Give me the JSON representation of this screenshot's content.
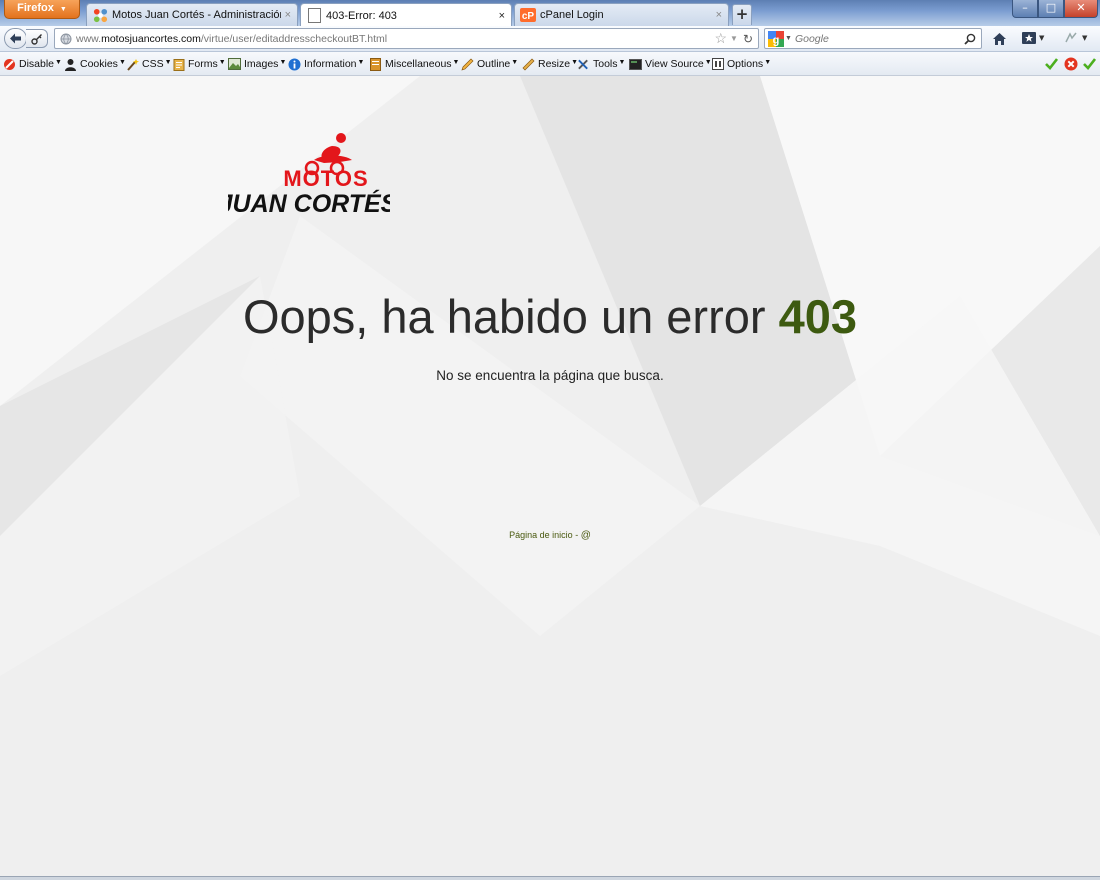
{
  "browser": {
    "menu_button": "Firefox",
    "tabs": [
      {
        "title": "Motos Juan Cortés - Administración",
        "icon": "joomla-icon",
        "active": false
      },
      {
        "title": "403-Error: 403",
        "icon": "blank-page-icon",
        "active": true
      },
      {
        "title": "cPanel Login",
        "icon": "cpanel-icon",
        "active": false
      }
    ],
    "tab_close_glyph": "×",
    "new_tab_glyph": "+",
    "window_buttons": {
      "minimize": "–",
      "maximize": "□",
      "close": "✕"
    }
  },
  "navbar": {
    "url_prefix": "www.",
    "url_host": "motosjuancortes.com",
    "url_path": "/virtue/user/editaddresscheckoutBT.html",
    "search_placeholder": "Google",
    "search_engine_icon": "google-icon"
  },
  "dev_toolbar": {
    "items": [
      "Disable",
      "Cookies",
      "CSS",
      "Forms",
      "Images",
      "Information",
      "Miscellaneous",
      "Outline",
      "Resize",
      "Tools",
      "View Source",
      "Options"
    ],
    "status_icons": [
      "check-icon",
      "error-icon",
      "check-icon"
    ]
  },
  "page": {
    "logo_line1": "MOTOS",
    "logo_line2": "JUAN CORTÉS",
    "error_message": "Oops, ha habido un error",
    "error_code": "403",
    "subtitle": "No se encuentra la página que busca.",
    "footer_link": "Página de inicio",
    "footer_separator": "-",
    "footer_at": "@",
    "colors": {
      "error_code": "#3d5a10",
      "logo_red": "#e3161b",
      "logo_black": "#111111",
      "background": "#efefef"
    }
  }
}
